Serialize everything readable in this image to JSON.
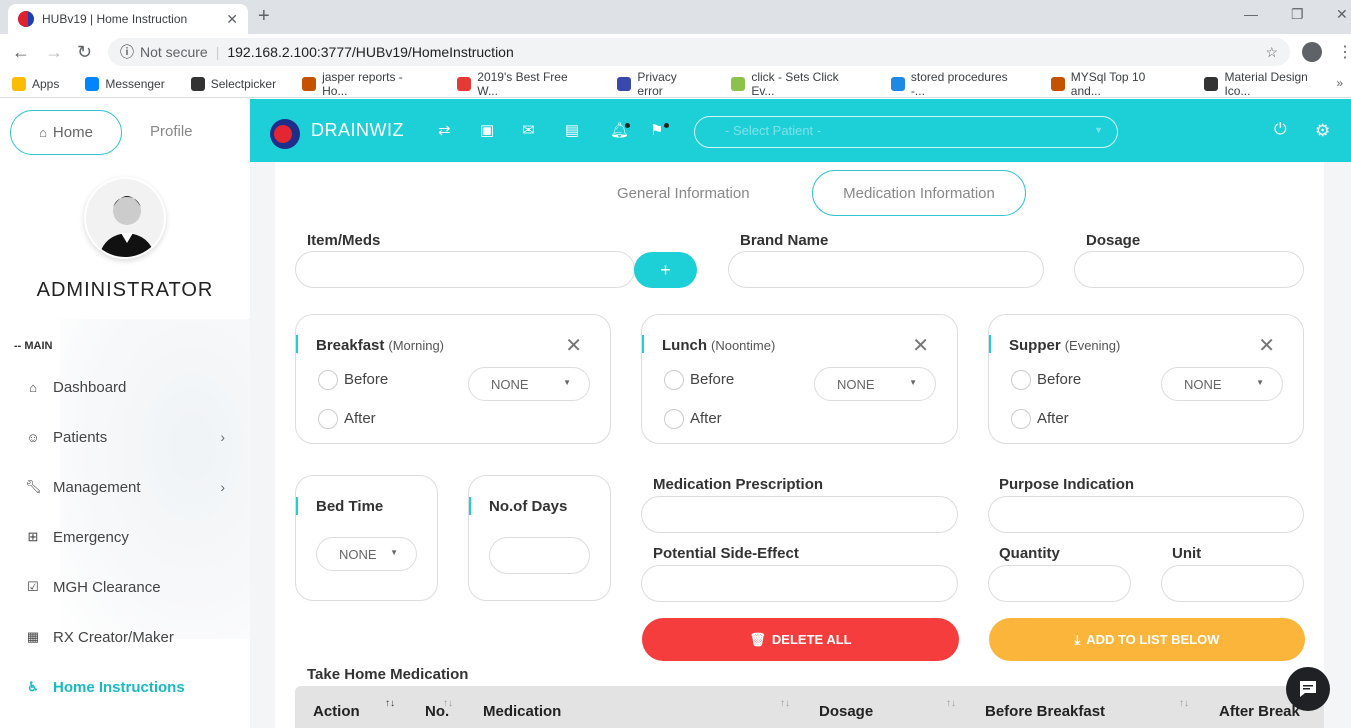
{
  "browser": {
    "tab_title": "HUBv19 | Home Instruction",
    "not_secure": "Not secure",
    "url": "192.168.2.100:3777/HUBv19/HomeInstruction",
    "bookmarks": [
      "Apps",
      "Messenger",
      "Selectpicker",
      "jasper reports - Ho...",
      "2019's Best Free W...",
      "Privacy error",
      "click - Sets Click Ev...",
      "stored procedures -...",
      "MYSql Top 10 and...",
      "Material Design Ico..."
    ]
  },
  "sidebar": {
    "home_label": "Home",
    "profile_label": "Profile",
    "username": "ADMINISTRATOR",
    "section_label": "-- MAIN",
    "items": [
      {
        "label": "Dashboard",
        "icon": "home-icon"
      },
      {
        "label": "Patients",
        "icon": "smile-icon"
      },
      {
        "label": "Management",
        "icon": "wrench-icon"
      },
      {
        "label": "Emergency",
        "icon": "plus-square-icon"
      },
      {
        "label": "MGH Clearance",
        "icon": "check-square-icon"
      },
      {
        "label": "RX Creator/Maker",
        "icon": "grid-icon"
      },
      {
        "label": "Home Instructions",
        "icon": "wheelchair-icon",
        "active": true
      }
    ]
  },
  "topbar": {
    "brand": "DRAINWIZ",
    "patient_placeholder": "- Select Patient -",
    "accent_color": "#1dd0d8"
  },
  "tabs": {
    "general": "General Information",
    "medication": "Medication Information"
  },
  "form": {
    "item_meds": "Item/Meds",
    "brand_name": "Brand Name",
    "dosage": "Dosage",
    "plus": "+",
    "meals": [
      {
        "title": "Breakfast",
        "sub": "(Morning)",
        "before": "Before",
        "after": "After",
        "select": "NONE"
      },
      {
        "title": "Lunch",
        "sub": "(Noontime)",
        "before": "Before",
        "after": "After",
        "select": "NONE"
      },
      {
        "title": "Supper",
        "sub": "(Evening)",
        "before": "Before",
        "after": "After",
        "select": "NONE"
      }
    ],
    "bed_time": "Bed Time",
    "bed_time_select": "NONE",
    "no_of_days": "No.of Days",
    "med_prescription": "Medication Prescription",
    "purpose_indication": "Purpose Indication",
    "side_effect": "Potential Side-Effect",
    "quantity": "Quantity",
    "unit": "Unit",
    "delete_all": "DELETE ALL",
    "add_to_list": "ADD TO LIST BELOW",
    "take_home": "Take Home Medication"
  },
  "table": {
    "headers": [
      "Action",
      "No.",
      "Medication",
      "Dosage",
      "Before Breakfast",
      "After Break"
    ]
  }
}
